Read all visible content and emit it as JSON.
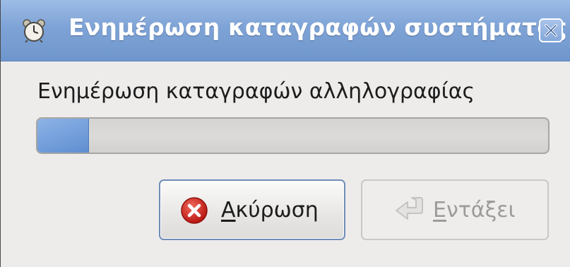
{
  "window": {
    "title": "Ενημέρωση καταγραφών συστήματος",
    "title_icon": "alarm-clock-icon",
    "close_icon": "close-icon"
  },
  "dialog": {
    "message": "Ενημέρωση καταγραφών αλληλογραφίας",
    "progress": {
      "fraction": 0.1
    }
  },
  "buttons": {
    "cancel": {
      "mnemonic": "Α",
      "label_rest": "κύρωση",
      "icon": "cancel-icon",
      "enabled": true
    },
    "ok": {
      "mnemonic": "Ε",
      "label_rest": "ντάξει",
      "icon": "return-arrow-icon",
      "enabled": false
    }
  },
  "colors": {
    "titlebar": "#7ea3d6",
    "progress_fill": "#7aa4de",
    "cancel_icon": "#d62b25"
  }
}
